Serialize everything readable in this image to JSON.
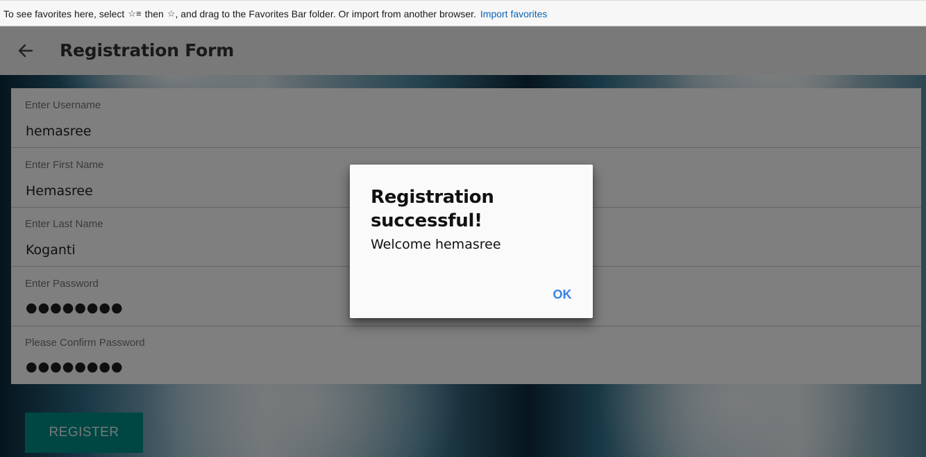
{
  "favorites_bar": {
    "text_before": "To see favorites here, select",
    "icon_1": "favorites-list-star-icon",
    "text_middle": "then",
    "icon_2": "star-icon",
    "text_after": ", and drag to the Favorites Bar folder. Or import from another browser.",
    "link": "Import favorites"
  },
  "appbar": {
    "back_icon": "arrow-left-icon",
    "title": "Registration Form"
  },
  "form": {
    "fields": [
      {
        "label": "Enter Username",
        "value": "hemasree"
      },
      {
        "label": "Enter First Name",
        "value": "Hemasree"
      },
      {
        "label": "Enter Last Name",
        "value": "Koganti"
      },
      {
        "label": "Enter Password",
        "value": "●●●●●●●●"
      },
      {
        "label": "Please Confirm Password",
        "value": "●●●●●●●●"
      }
    ],
    "register_label": "REGISTER"
  },
  "dialog": {
    "title": "Registration successful!",
    "message": "Welcome hemasree",
    "ok_label": "OK"
  },
  "colors": {
    "accent_button": "#008f86",
    "dialog_ok": "#3b82e6",
    "link": "#0a63b8"
  }
}
